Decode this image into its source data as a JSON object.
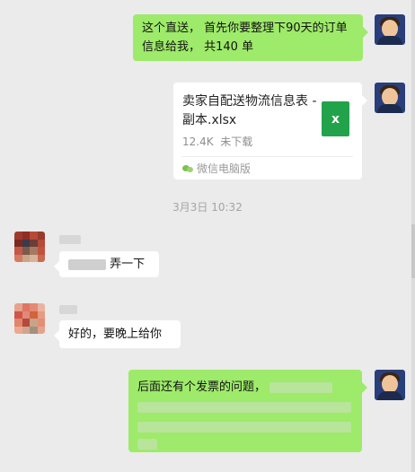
{
  "messages": [
    {
      "sender": "me",
      "type": "text",
      "text": "这个直送， 首先你要整理下90天的订单信息给我， 共140 单"
    },
    {
      "sender": "me",
      "type": "file",
      "file_name": "卖家自配送物流信息表 - 副本.xlsx",
      "file_size": "12.4K",
      "file_status": "未下载",
      "file_icon": "excel-icon",
      "file_icon_letter": "x",
      "source": "微信电脑版"
    },
    {
      "type": "timestamp",
      "text": "3月3日 10:32"
    },
    {
      "sender": "other",
      "type": "text",
      "text_suffix": "弄一下"
    },
    {
      "sender": "other",
      "type": "text",
      "text": "好的，要晚上给你"
    },
    {
      "sender": "me",
      "type": "text",
      "text": "后面还有个发票的问题，"
    }
  ],
  "colors": {
    "background": "#ebebeb",
    "my_bubble": "#9eea6a",
    "other_bubble": "#ffffff",
    "excel_green": "#22a34b",
    "timestamp_text": "#a4a4a4"
  }
}
